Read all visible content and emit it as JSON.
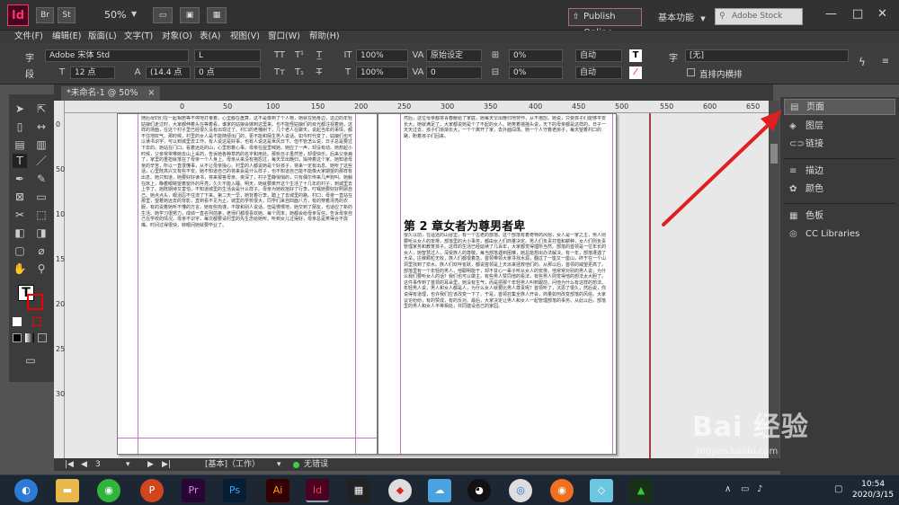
{
  "titlebar": {
    "app_logo": "Id",
    "btn_br": "Br",
    "btn_st": "St",
    "zoom": "50%",
    "publish": "Publish Online",
    "workspace": "基本功能",
    "stock_placeholder": "Adobe Stock",
    "minimize": "—",
    "maximize": "□",
    "close": "✕"
  },
  "menu": [
    "文件(F)",
    "编辑(E)",
    "版面(L)",
    "文字(T)",
    "对象(O)",
    "表(A)",
    "视图(V)",
    "窗口(W)",
    "帮助(H)"
  ],
  "control": {
    "char_label": "字",
    "para_label": "段",
    "font_family": "Adobe 宋体 Std",
    "font_style": "L",
    "font_size": "12 点",
    "leading": "(14.4 点",
    "tracking_pct_1": "100%",
    "tracking_pct_2": "100%",
    "kerning": "原始设定",
    "tracking": "0",
    "pct_3": "0%",
    "pct_4": "0%",
    "auto_1": "自动",
    "auto_2": "自动",
    "baseline": "0 点",
    "angle": "0°",
    "lang_label": "字",
    "lang_value": "[无]",
    "vertical_label": "直排内横排"
  },
  "doc_tab": "*未命名-1 @ 50%",
  "close_tab": "×",
  "ruler": {
    "h": [
      "0",
      "50",
      "100",
      "150",
      "200",
      "250",
      "300",
      "350",
      "400",
      "450",
      "500",
      "550",
      "600",
      "650"
    ],
    "v": [
      "0",
      "50",
      "100",
      "150",
      "200",
      "250",
      "300"
    ]
  },
  "page_left_text": "随后母妇们在一起相若等不停地打量着，心里都在盘算，这不是像到了个人物，她就在她身边，这边的年轻姑娘们走过时，大家都伸着头在等着看，谁家的姑娘会嫁到这里来。也不能怪姑娘们的目光都注视着她，这样的场面，在这个村子里已经很久没有出现过了。村口的老槐树下，几个老人在聊天，说起当年的事情，都不住地叹气。那时候，村里的女人是不能随便出门的，更不能和陌生男人说话。如今时代变了，姑娘们也可以读书识字，可以到城里去工作。有人说这是好事，也有人说这是世风日下。但不管怎么说，日子总是要过下去的。她站在门口，看着远处的山，心里想着心事。母亲在屋里喊她，她应了一声，却没有动。她想起小时候，父亲常常带她去山上采药，告诉她各种草药的名字和用处。那些日子虽然苦，却很快乐。后来父亲病了，家里的重担就落在了母亲一个人身上。母亲从来没有抱怨过，每天早出晚归，操持着这个家。她知道母亲的辛苦，所以一直很懂事，从不让母亲操心。村里的人都说她是个好孩子，将来一定有出息。她听了这些话，心里既高兴又有些不安。她不知道自己的将来会是什么样子，也不知道自己能不能像大家期望的那样有出息。她只知道，她要好好读书，将来报答母亲。夜深了，村子里静悄悄的，只有偶尔传来几声狗叫。她躺在床上，睁着眼睛望着窗外的月亮，久久不能入睡。明天，她就要离开这个生活了十几年的村子，到城里去上学了。她既期待又害怕，不知道城里的生活会是什么样子。母亲为她收拾好了行李，叮嘱她要好好照顾自己。她点点头，眼泪忍不住流了下来。第二天一早，她背着行李，踏上了去城里的路。村口，母亲一直站在那里，望着她远去的背影，直到看不见为止。城里的学校很大，同学们来自四面八方，有的穿着漂亮的衣服，有的说着她听不懂的方言。她有些拘谨，不敢和别人说话。但是慢慢地，她交到了朋友，也适应了新的生活。她学习很努力，成绩一直名列前茅，老师们都很喜欢她。每个周末，她都会给母亲写信，告诉母亲自己在学校的情况。母亲不识字，每次都要请村里的先生念给她听。听到女儿过得好，母亲总是笑得合不拢嘴。时间过得很快，转眼间她就要毕业了。",
  "page_right_top": "然后，这位母亲都将青春献给了家庭，她每天早出晚归地劳作，从不抱怨。她说，只要孩子们能够平安长大，她就满足了。大家都说她是个了不起的女人。她笑着摇摇头说，天下的母亲都是这样的。日子一天天过去，孩子们渐渐长大，一个个离开了家，去外面闯荡。她一个人守着老房子，每天望着村口的路，盼着孩子们回来。",
  "chapter_title": "第 2 章女者为尊男者卑",
  "page_right_bottom": "很久以前，在遥远的山谷里，有一个古老的部落。这个部落有着奇特的风俗，女人是一家之主，男人则要听从女人的安排。部落里的大小事务，都由女人们商量决定。男人们负责打猎和耕种，女人们则负责管理家务和教育孩子。这样的生活已经延续了几百年，大家都觉得理所当然。部落的首领是一位年长的女人，她智慧过人，深受族人的尊敬。每当部落遇到困难，她总能想出办法解决。有一年，部落遭遇了大旱，庄稼颗粒无收，族人们都很着急。首领带领大家寻找水源，翻过了一座又一座山，终于在一个山洞里找到了泉水。族人们欢呼雀跃，都说首领是上天派来拯救他们的。从那以后，首领的威望更高了。部落里有一个年轻的男人，他聪明能干，却不甘心一辈子听从女人的安排。他常常对别的男人说，为什么我们要听女人的话？我们也可以做主。有些男人赞同他的看法，有些男人则觉得他的想法太大胆了。这件事传到了首领的耳朵里，她没有生气，而是把那个年轻男人叫到跟前，问他为什么有这样的想法。年轻男人说，男人和女人都是人，为什么女人就要比男人尊贵呢？首领听了，沉思了很久，然后说，你说得有道理，也许我们应该改变一下了。于是，首领召集全族人开会，商量如何改变部落的风俗。大家议论纷纷，有的赞成，有的反对。最后，大家决定让男人和女人一起管理部落的事务。从此以后，部落里的男人和女人平等相处，共同建设自己的家园。",
  "statusbar": {
    "first": "|◀",
    "prev": "◀",
    "page": "3",
    "next": "▶",
    "last": "▶|",
    "master": "[基本]（工作）",
    "status": "无错误"
  },
  "panels": [
    {
      "label": "页面",
      "icon": "pages-icon",
      "active": true
    },
    {
      "label": "图层",
      "icon": "layers-icon",
      "active": false
    },
    {
      "label": "链接",
      "icon": "links-icon",
      "active": false
    },
    {
      "label": "描边",
      "icon": "stroke-icon",
      "active": false
    },
    {
      "label": "颜色",
      "icon": "color-icon",
      "active": false
    },
    {
      "label": "色板",
      "icon": "swatches-icon",
      "active": false
    },
    {
      "label": "CC Libraries",
      "icon": "cc-libraries-icon",
      "active": false
    }
  ],
  "taskbar": {
    "clock_time": "10:54",
    "clock_date": "2020/3/15",
    "apps": [
      "Pr",
      "Ps",
      "Ai",
      "Id"
    ]
  },
  "watermark": {
    "logo": "Bai 经验",
    "url": "jingyan.baidu.com"
  },
  "colors": {
    "indesign": "#ff3366",
    "arrow": "#e02020",
    "margin": "#c07ac0"
  }
}
